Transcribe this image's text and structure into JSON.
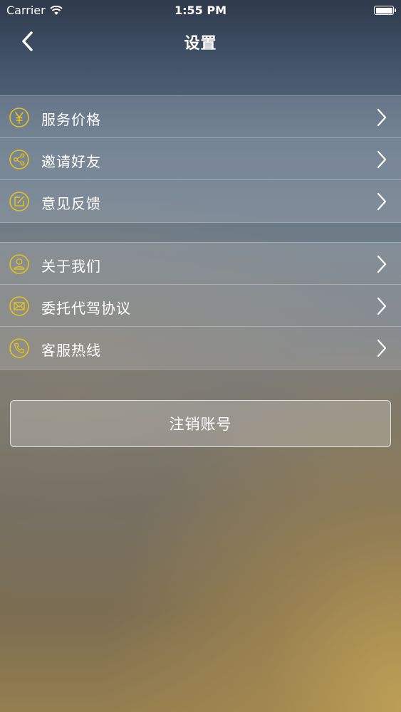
{
  "status_bar": {
    "carrier": "Carrier",
    "time": "1:55 PM",
    "wifi_icon": "wifi-icon",
    "battery_icon": "battery-icon",
    "battery_level": 1.0
  },
  "nav": {
    "title": "设置",
    "back_icon": "chevron-left-icon"
  },
  "groups": [
    {
      "items": [
        {
          "label": "服务价格",
          "icon": "yen-icon"
        },
        {
          "label": "邀请好友",
          "icon": "share-icon"
        },
        {
          "label": "意见反馈",
          "icon": "edit-icon"
        }
      ]
    },
    {
      "items": [
        {
          "label": "关于我们",
          "icon": "user-icon"
        },
        {
          "label": "委托代驾协议",
          "icon": "mail-icon"
        },
        {
          "label": "客服热线",
          "icon": "phone-icon"
        }
      ]
    }
  ],
  "logout_button": {
    "label": "注销账号"
  },
  "colors": {
    "icon_accent": "#e4c21a",
    "text": "#ffffff"
  }
}
